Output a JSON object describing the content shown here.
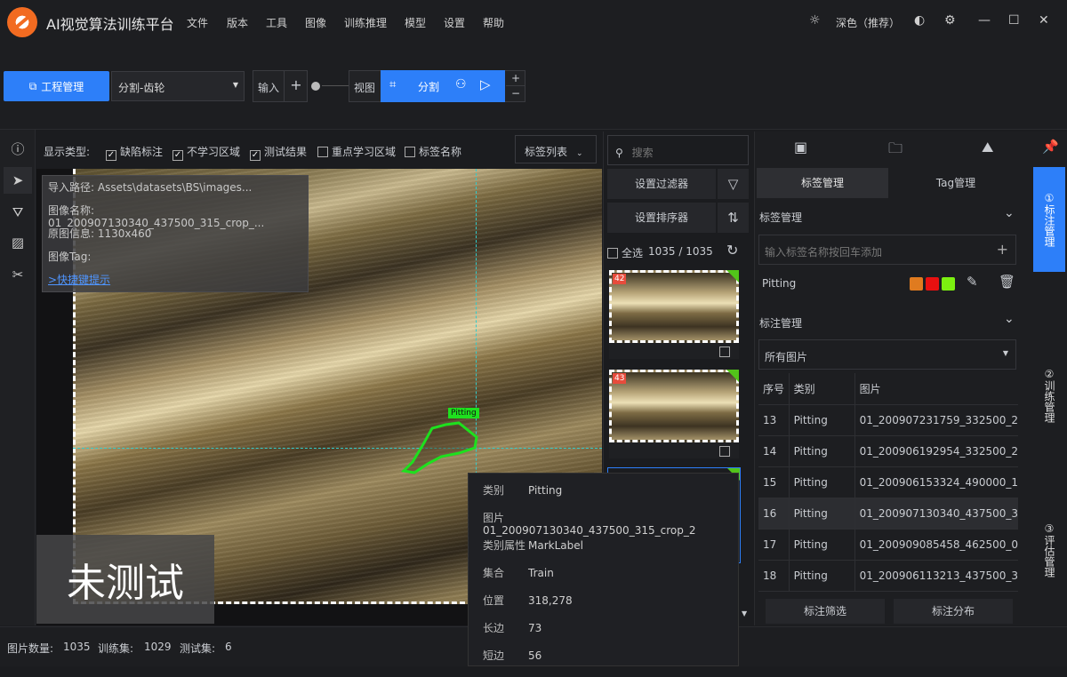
{
  "window": {
    "title": "AI视觉算法训练平台",
    "theme_label": "深色（推荐）"
  },
  "menu": [
    "文件",
    "版本",
    "工具",
    "图像",
    "训练推理",
    "模型",
    "设置",
    "帮助"
  ],
  "toolbar": {
    "project_button": "工程管理",
    "project_select": "分割-齿轮",
    "input_label": "输入",
    "view_label": "视图",
    "segment_label": "分割",
    "plus": "+",
    "minus": "−"
  },
  "display": {
    "type_label": "显示类型:",
    "options": [
      {
        "label": "缺陷标注",
        "checked": true
      },
      {
        "label": "不学习区域",
        "checked": true
      },
      {
        "label": "测试结果",
        "checked": true
      },
      {
        "label": "重点学习区域",
        "checked": false
      },
      {
        "label": "标签名称",
        "checked": false
      }
    ],
    "tag_list_button": "标签列表"
  },
  "info": {
    "path": "导入路径: Assets\\datasets\\BS\\images...",
    "name": "图像名称: 01_200907130340_437500_315_crop_...",
    "original": "原图信息: 1130x460",
    "tag": "图像Tag:",
    "shortcut_link": ">快捷键提示"
  },
  "canvas": {
    "status": "未测试",
    "annotation_label": "Pitting"
  },
  "thumbs": {
    "search_placeholder": "搜索",
    "filter_button": "设置过滤器",
    "sort_button": "设置排序器",
    "select_all": "全选",
    "count": "1035 / 1035",
    "items": [
      {
        "num": "42"
      },
      {
        "num": "43"
      }
    ]
  },
  "tooltip": {
    "rows": [
      {
        "k": "类别",
        "v": "Pitting"
      },
      {
        "k": "图片",
        "v": "01_200907130340_437500_315_crop_2"
      },
      {
        "k": "类别属性",
        "v": "MarkLabel"
      },
      {
        "k": "集合",
        "v": "Train"
      },
      {
        "k": "位置",
        "v": "318,278"
      },
      {
        "k": "长边",
        "v": "73"
      },
      {
        "k": "短边",
        "v": "56"
      }
    ]
  },
  "right": {
    "tab_label_mgmt": "标签管理",
    "tab_tag_mgmt": "Tag管理",
    "section_label": "标签管理",
    "label_input_placeholder": "输入标签名称按回车添加",
    "label_name": "Pitting",
    "label_colors": [
      "#e07b1f",
      "#e81010",
      "#7cf010"
    ],
    "section_annotation": "标注管理",
    "image_filter": "所有图片",
    "table": {
      "headers": [
        "序号",
        "类别",
        "图片"
      ],
      "rows": [
        [
          "13",
          "Pitting",
          "01_200907231759_332500_2"
        ],
        [
          "14",
          "Pitting",
          "01_200906192954_332500_2"
        ],
        [
          "15",
          "Pitting",
          "01_200906153324_490000_1"
        ],
        [
          "16",
          "Pitting",
          "01_200907130340_437500_3"
        ],
        [
          "17",
          "Pitting",
          "01_200909085458_462500_0"
        ],
        [
          "18",
          "Pitting",
          "01_200906113213_437500_3"
        ]
      ]
    },
    "btn_filter": "标注筛选",
    "btn_dist": "标注分布"
  },
  "sidetabs": [
    "①标注管理",
    "②训练管理",
    "③评估管理"
  ],
  "status": {
    "img_count_label": "图片数量:",
    "img_count": "1035",
    "train_label": "训练集:",
    "train": "1029",
    "test_label": "测试集:",
    "test": "6"
  }
}
